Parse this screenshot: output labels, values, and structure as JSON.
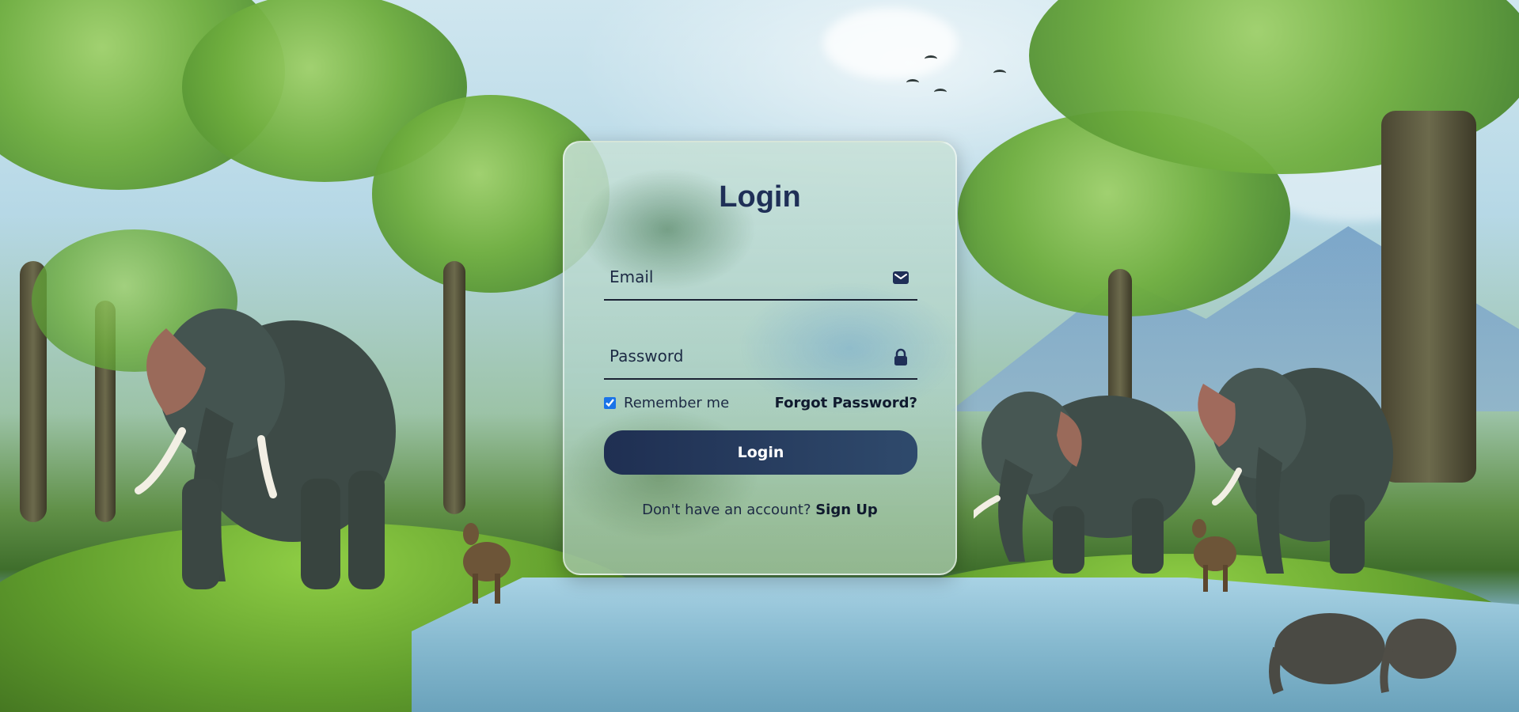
{
  "login": {
    "title": "Login",
    "email_placeholder": "Email",
    "password_placeholder": "Password",
    "remember_label": "Remember me",
    "remember_checked": true,
    "forgot_label": "Forgot Password?",
    "submit_label": "Login",
    "signup_prompt": "Don't have an account?",
    "signup_label": "Sign Up"
  },
  "icons": {
    "email": "envelope-icon",
    "password": "lock-icon"
  },
  "colors": {
    "title": "#1f2f57",
    "button_start": "#1f2f52",
    "button_end": "#2f4a6c",
    "text": "#1d2a44"
  }
}
